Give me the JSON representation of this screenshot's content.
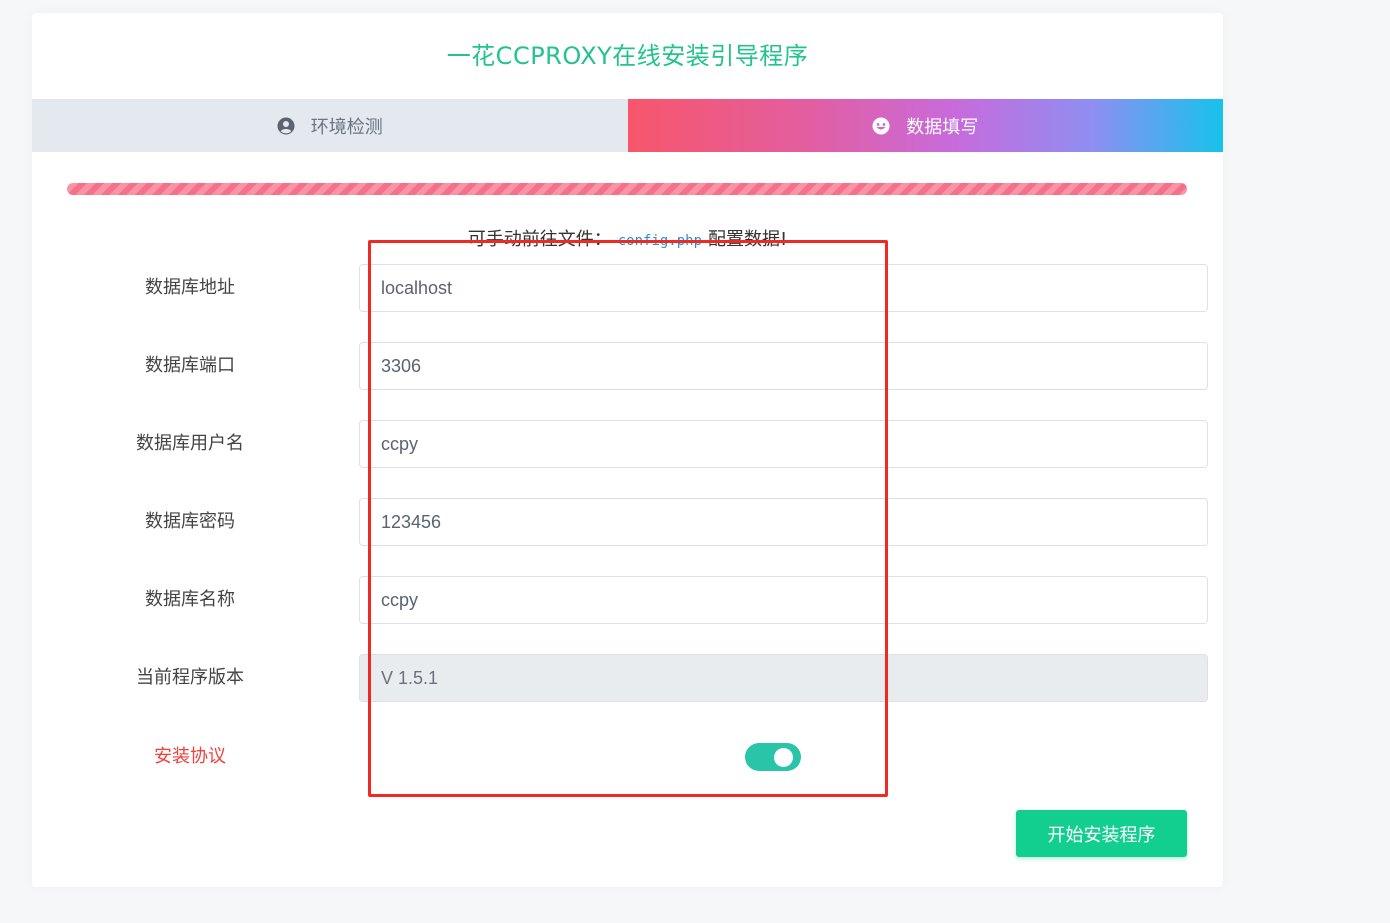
{
  "title": "一花CCPROXY在线安装引导程序",
  "tabs": [
    {
      "label": "环境检测",
      "icon": "user-circle-icon",
      "active": false
    },
    {
      "label": "数据填写",
      "icon": "smile-icon",
      "active": true
    }
  ],
  "progress": {
    "percent": 100
  },
  "hint": {
    "prefix": "可手动前往文件：",
    "file": "config.php",
    "suffix": "配置数据!"
  },
  "fields": [
    {
      "label": "数据库地址",
      "value": "localhost",
      "disabled": false
    },
    {
      "label": "数据库端口",
      "value": "3306",
      "disabled": false
    },
    {
      "label": "数据库用户名",
      "value": "ccpy",
      "disabled": false
    },
    {
      "label": "数据库密码",
      "value": "123456",
      "disabled": false
    },
    {
      "label": "数据库名称",
      "value": "ccpy",
      "disabled": false
    },
    {
      "label": "当前程序版本",
      "value": "V 1.5.1",
      "disabled": true
    }
  ],
  "agreement": {
    "label": "安装协议",
    "checked": true
  },
  "install_button": "开始安装程序",
  "colors": {
    "title": "#22c38e",
    "progress": "#f7708a",
    "toggle": "#2ac5a9",
    "button": "#13cf8f",
    "annotation": "#ee2a22"
  }
}
